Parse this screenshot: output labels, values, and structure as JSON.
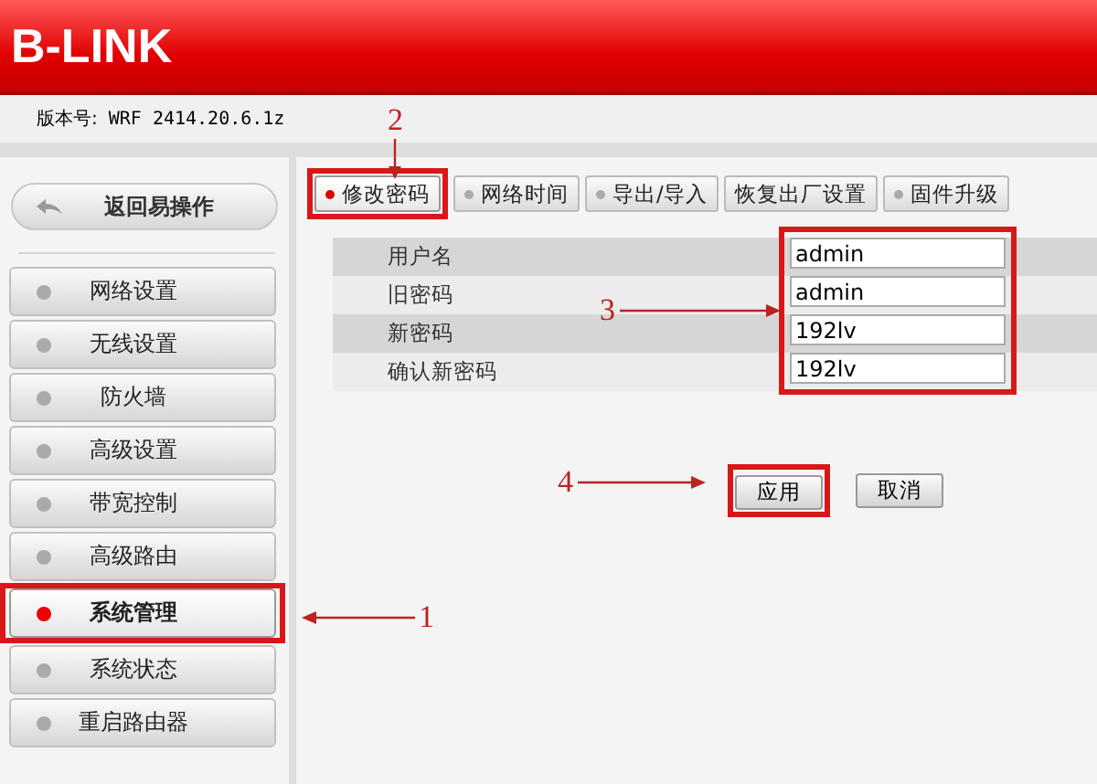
{
  "header": {
    "logo": "B-LINK"
  },
  "version": {
    "label": "版本号:",
    "value": "WRF 2414.20.6.1z"
  },
  "back_button": {
    "label": "返回易操作"
  },
  "sidebar": {
    "items": [
      {
        "label": "网络设置",
        "selected": false,
        "highlighted": false
      },
      {
        "label": "无线设置",
        "selected": false,
        "highlighted": false
      },
      {
        "label": "防火墙",
        "selected": false,
        "highlighted": false
      },
      {
        "label": "高级设置",
        "selected": false,
        "highlighted": false
      },
      {
        "label": "带宽控制",
        "selected": false,
        "highlighted": false
      },
      {
        "label": "高级路由",
        "selected": false,
        "highlighted": false
      },
      {
        "label": "系统管理",
        "selected": true,
        "highlighted": true
      },
      {
        "label": "系统状态",
        "selected": false,
        "highlighted": false
      },
      {
        "label": "重启路由器",
        "selected": false,
        "highlighted": false
      }
    ]
  },
  "tabs": [
    {
      "label": "修改密码",
      "selected": true,
      "dot": true,
      "highlighted": true
    },
    {
      "label": "网络时间",
      "selected": false,
      "dot": true,
      "highlighted": false
    },
    {
      "label": "导出/导入",
      "selected": false,
      "dot": true,
      "highlighted": false
    },
    {
      "label": "恢复出厂设置",
      "selected": false,
      "dot": false,
      "highlighted": false
    },
    {
      "label": "固件升级",
      "selected": false,
      "dot": true,
      "highlighted": false
    }
  ],
  "form": {
    "fields_highlighted": true,
    "rows": [
      {
        "label": "用户名",
        "value": "admin"
      },
      {
        "label": "旧密码",
        "value": "admin"
      },
      {
        "label": "新密码",
        "value": "192lv"
      },
      {
        "label": "确认新密码",
        "value": "192lv"
      }
    ]
  },
  "buttons": [
    {
      "label": "应用",
      "highlighted": true
    },
    {
      "label": "取消",
      "highlighted": false
    }
  ],
  "annotations": [
    {
      "label": "2"
    },
    {
      "label": "1"
    },
    {
      "label": "3"
    },
    {
      "label": "4"
    }
  ]
}
